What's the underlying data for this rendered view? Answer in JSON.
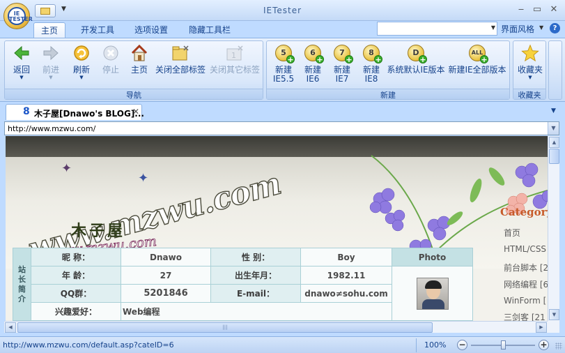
{
  "window": {
    "title": "IETester",
    "orb_text": "IE\nTESTER"
  },
  "ribbon_tabs": [
    "主页",
    "开发工具",
    "选项设置",
    "隐藏工具栏"
  ],
  "right_controls": {
    "style_label": "界面风格",
    "help": "?"
  },
  "groups": {
    "nav": {
      "label": "导航",
      "buttons": [
        {
          "label": "返回",
          "icon": "back-arrow-icon",
          "enabled": true
        },
        {
          "label": "前进",
          "icon": "forward-arrow-icon",
          "enabled": false
        },
        {
          "label": "刷新",
          "icon": "refresh-icon",
          "enabled": true
        },
        {
          "label": "停止",
          "icon": "stop-icon",
          "enabled": false
        },
        {
          "label": "主页",
          "icon": "home-icon",
          "enabled": true
        },
        {
          "label": "关闭全部标签",
          "icon": "close-all-tabs-icon",
          "enabled": true
        },
        {
          "label": "关闭其它标签",
          "icon": "close-other-tabs-icon",
          "enabled": false
        }
      ]
    },
    "new": {
      "label": "新建",
      "buttons": [
        {
          "label": "新建",
          "sub": "IE5.5",
          "badge": "5"
        },
        {
          "label": "新建",
          "sub": "IE6",
          "badge": "6"
        },
        {
          "label": "新建",
          "sub": "IE7",
          "badge": "7"
        },
        {
          "label": "新建",
          "sub": "IE8",
          "badge": "8"
        },
        {
          "label": "系统默认IE版本",
          "sub": "",
          "badge": "D"
        },
        {
          "label": "新建IE全部版本",
          "sub": "",
          "badge": "ALL"
        }
      ]
    },
    "fav": {
      "label": "收藏夹",
      "button": "收藏夹"
    }
  },
  "doc_tab": {
    "badge": "8",
    "title": "木子屋[Dnawo's BLOG]...",
    "close": "✕"
  },
  "address": {
    "url": "http://www.mzwu.com/"
  },
  "webpage": {
    "logo_url": "www.mzwu.com",
    "logo_cn": "木子屋",
    "logo_sub": "www.mzwu.com",
    "category_title": "Category",
    "categories": [
      "首页",
      "HTML/CSS",
      "前台脚本 [2",
      "网络编程 [6",
      "WinForm [",
      "三剑客 [21"
    ],
    "profile": {
      "side_label": [
        "站",
        "长",
        "简",
        "介"
      ],
      "rows": [
        {
          "l1": "昵 称：",
          "v1": "Dnawo",
          "l2": "性 别：",
          "v2": "Boy"
        },
        {
          "l1": "年 龄：",
          "v1": "27",
          "l2": "出生年月：",
          "v2": "1982.11"
        },
        {
          "l1": "QQ群：",
          "v1": "5201846",
          "l2": "E-mail：",
          "v2": "dnawo≠sohu.com"
        },
        {
          "l1": "兴趣爱好：",
          "v1": "Web编程",
          "l2": "",
          "v2": ""
        }
      ],
      "photo_header": "Photo"
    }
  },
  "status": {
    "url": "http://www.mzwu.com/default.asp?cateID=6",
    "zoom": "100%"
  }
}
